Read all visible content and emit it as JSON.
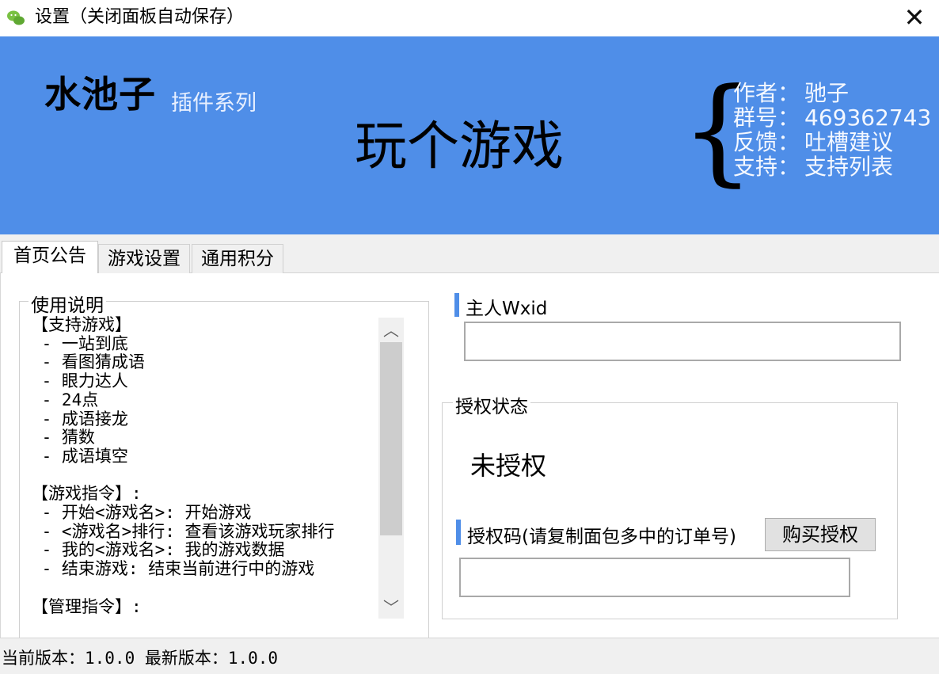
{
  "window": {
    "title": "设置（关闭面板自动保存）",
    "close_icon": "✕"
  },
  "banner": {
    "brand": "水池子",
    "brand_sub": "插件系列",
    "game_title": "玩个游戏",
    "brace": "{",
    "info": [
      {
        "label": "作者：",
        "value": "驰子"
      },
      {
        "label": "群号：",
        "value": "469362743"
      },
      {
        "label": "反馈：",
        "value": "吐槽建议"
      },
      {
        "label": "支持：",
        "value": "支持列表"
      }
    ],
    "accent_color": "#4f8ee8"
  },
  "tabs": [
    {
      "label": "首页公告",
      "active": true
    },
    {
      "label": "游戏设置",
      "active": false
    },
    {
      "label": "通用积分",
      "active": false
    }
  ],
  "instructions": {
    "group_label": "使用说明",
    "text": "【支持游戏】\n - 一站到底\n - 看图猜成语\n - 眼力达人\n - 24点\n - 成语接龙\n - 猜数\n - 成语填空\n\n【游戏指令】:\n - 开始<游戏名>: 开始游戏\n - <游戏名>排行: 查看该游戏玩家排行\n - 我的<游戏名>: 我的游戏数据\n - 结束游戏: 结束当前进行中的游戏\n\n【管理指令】:",
    "scroll_up_icon": "︿",
    "scroll_down_icon": "﹀"
  },
  "owner": {
    "label": "主人Wxid",
    "value": ""
  },
  "auth": {
    "group_label": "授权状态",
    "status": "未授权",
    "code_label": "授权码(请复制面包多中的订单号)",
    "buy_button": "购买授权",
    "code_value": ""
  },
  "statusbar": {
    "version_text": "当前版本：1.0.0  最新版本：1.0.0"
  }
}
